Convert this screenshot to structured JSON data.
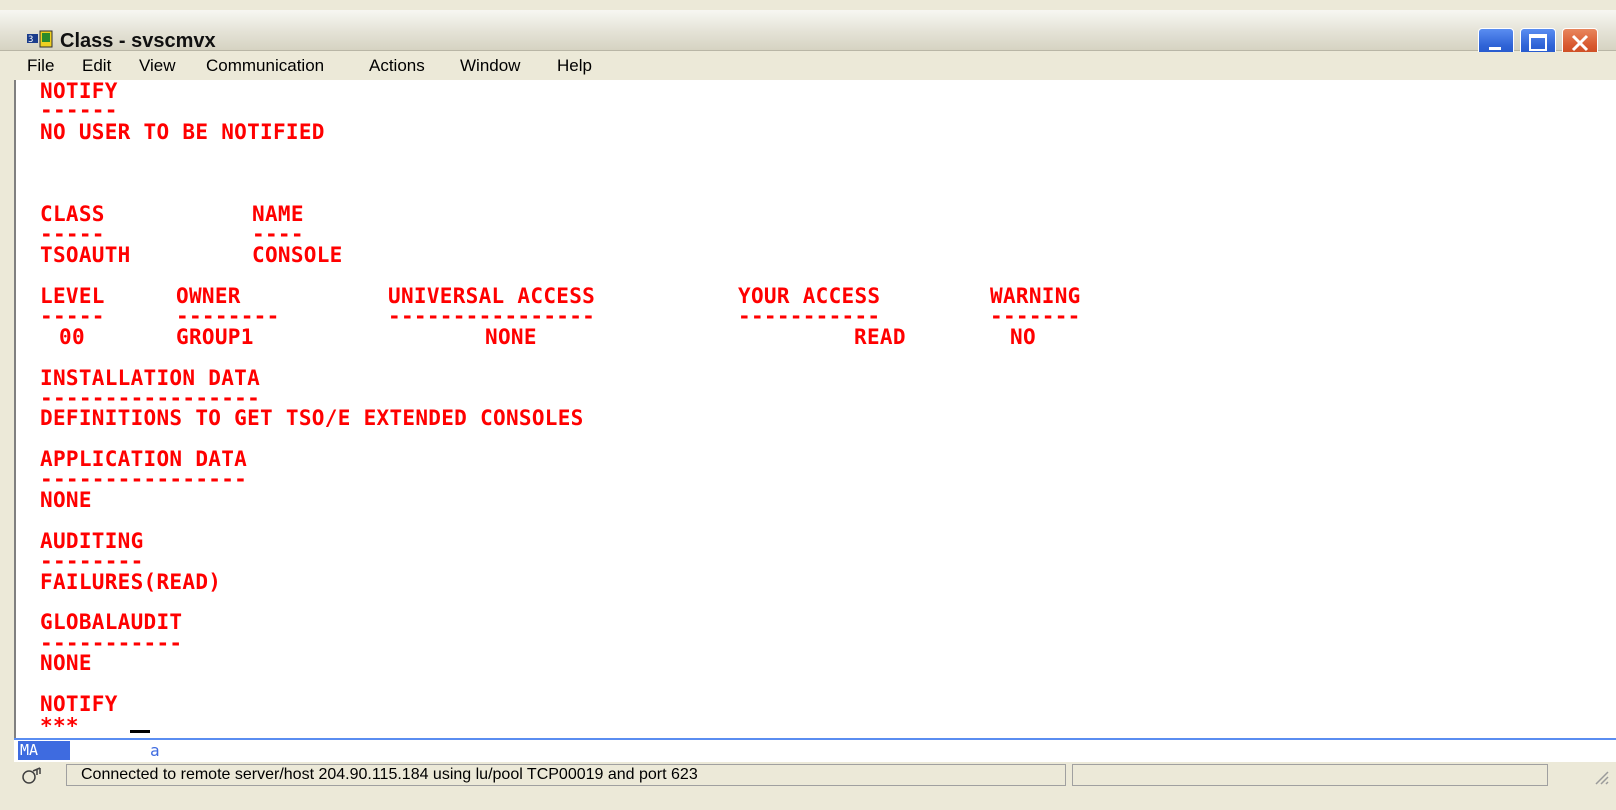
{
  "window": {
    "title": "Class - svscmvx",
    "app_icon": "terminal-emulator-icon"
  },
  "menu": [
    "File",
    "Edit",
    "View",
    "Communication",
    "Actions",
    "Window",
    "Help"
  ],
  "terminal_lines": {
    "notify_top": "NOTIFY",
    "notify_top_rule": "------",
    "no_user": "NO USER TO BE NOTIFIED",
    "class_hdr": "CLASS",
    "name_hdr": "NAME",
    "class_rule": "-----",
    "name_rule": "----",
    "class_val": "TSOAUTH",
    "name_val": "CONSOLE",
    "level_hdr": "LEVEL",
    "owner_hdr": "OWNER",
    "uacc_hdr": "UNIVERSAL ACCESS",
    "youracc_hdr": "YOUR ACCESS",
    "warning_hdr": "WARNING",
    "level_rule": "-----",
    "owner_rule": "--------",
    "uacc_rule": "----------------",
    "youracc_rule": "-----------",
    "warning_rule": "-------",
    "level_val": "00",
    "owner_val": "GROUP1",
    "uacc_val": "NONE",
    "youracc_val": "READ",
    "warning_val": "NO",
    "install_hdr": "INSTALLATION DATA",
    "install_rule": "-----------------",
    "install_val": "DEFINITIONS TO GET TSO/E EXTENDED CONSOLES",
    "appl_hdr": "APPLICATION DATA",
    "appl_rule": "----------------",
    "appl_val": "NONE",
    "audit_hdr": "AUDITING",
    "audit_rule": "--------",
    "audit_val": "FAILURES(READ)",
    "gaudit_hdr": "GLOBALAUDIT",
    "gaudit_rule": "-----------",
    "gaudit_val": "NONE",
    "notify_bottom": "NOTIFY",
    "prompt": "***"
  },
  "oia": {
    "mode": "MA",
    "indicator": "a"
  },
  "status": {
    "message": "Connected to remote server/host 204.90.115.184 using lu/pool TCP00019 and port 623"
  },
  "colors": {
    "terminal_text": "#ff0000",
    "oia_accent": "#3e6be0"
  }
}
